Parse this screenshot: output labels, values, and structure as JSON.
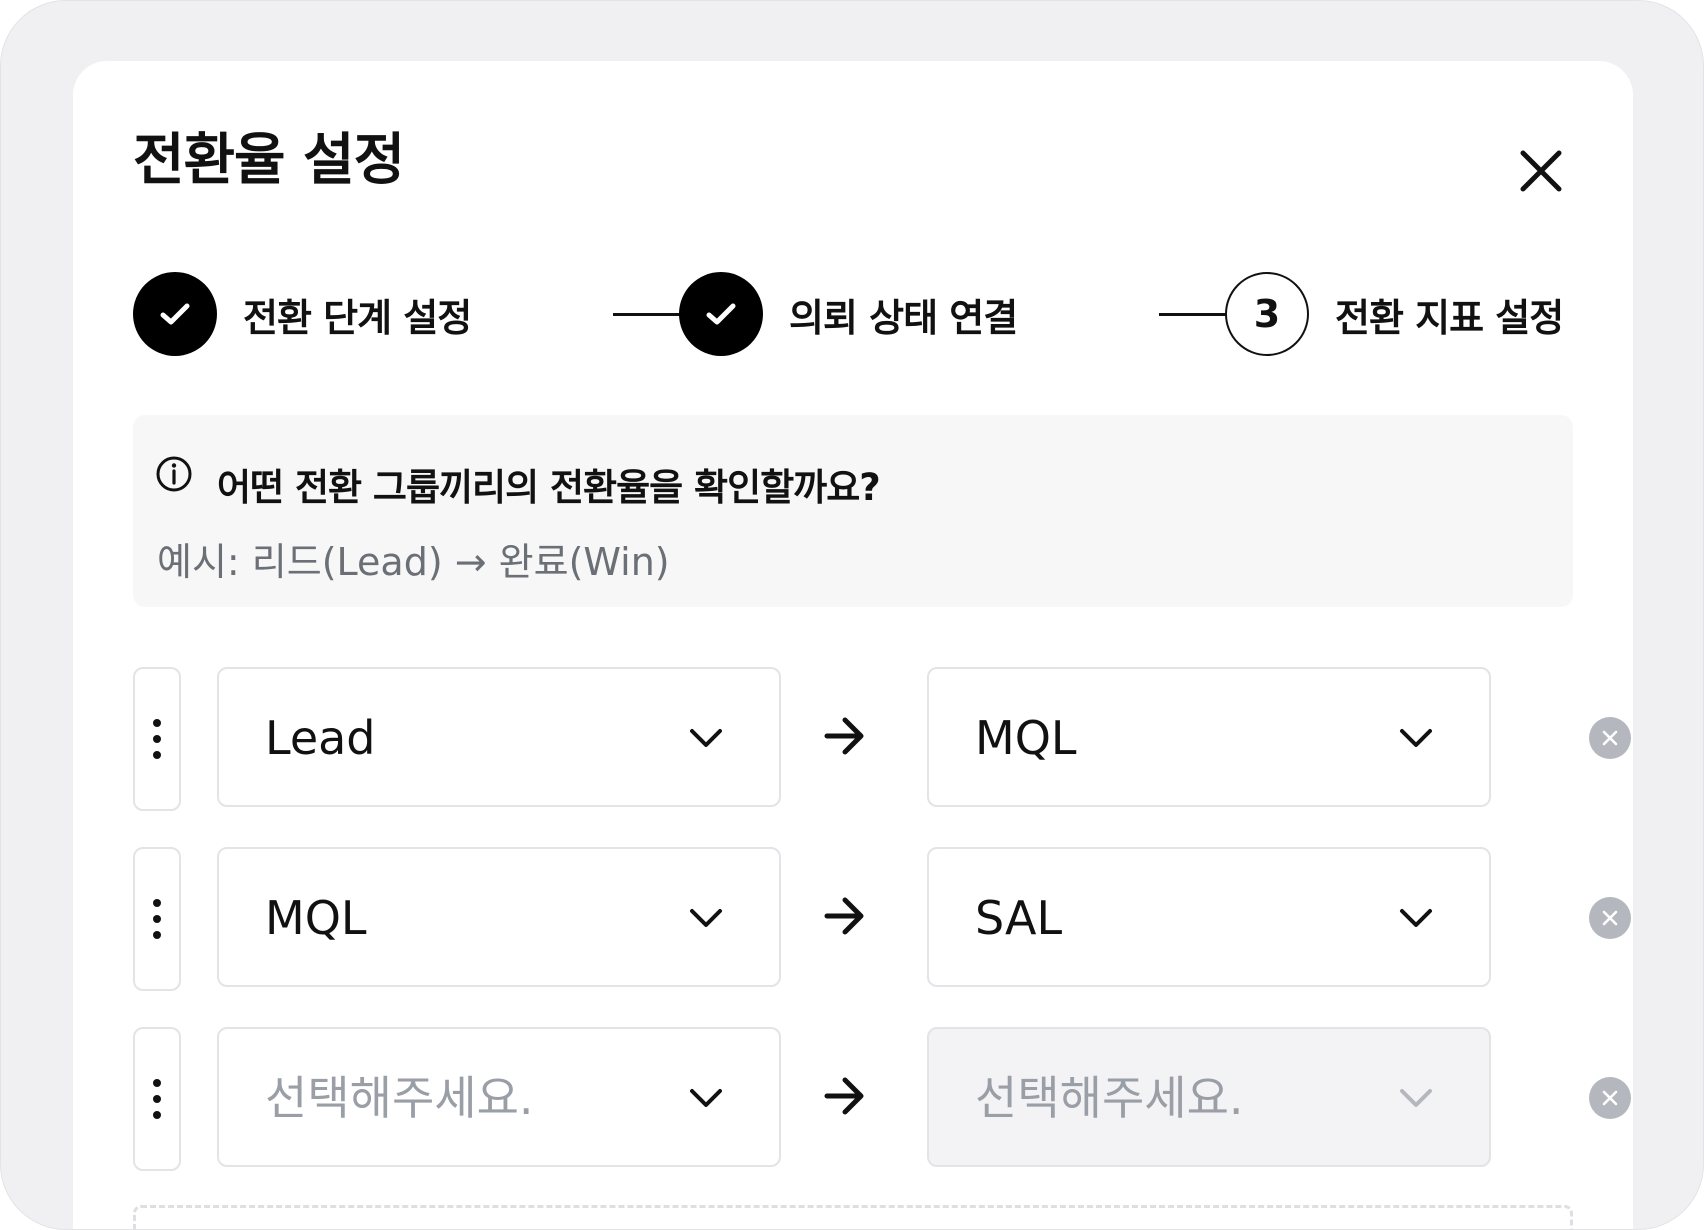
{
  "modal": {
    "title": "전환율 설정"
  },
  "steps": [
    {
      "label": "전환 단계 설정",
      "status": "done"
    },
    {
      "label": "의뢰 상태 연결",
      "status": "done"
    },
    {
      "label": "전환 지표 설정",
      "status": "current",
      "number": "3"
    }
  ],
  "info": {
    "icon": "info-icon",
    "title": "어떤 전환 그룹끼리의 전환율을 확인할까요?",
    "example": "예시: 리드(Lead) → 완료(Win)"
  },
  "rows": [
    {
      "from": "Lead",
      "to": "MQL"
    },
    {
      "from": "MQL",
      "to": "SAL"
    },
    {
      "from_placeholder": "선택해주세요.",
      "to_placeholder": "선택해주세요.",
      "to_disabled": true
    }
  ],
  "colors": {
    "primary": "#000000",
    "border": "#e3e4e7",
    "placeholder": "#9a9ea6",
    "remove_icon_bg": "#b4b7be",
    "info_bg": "#f7f7f8"
  }
}
